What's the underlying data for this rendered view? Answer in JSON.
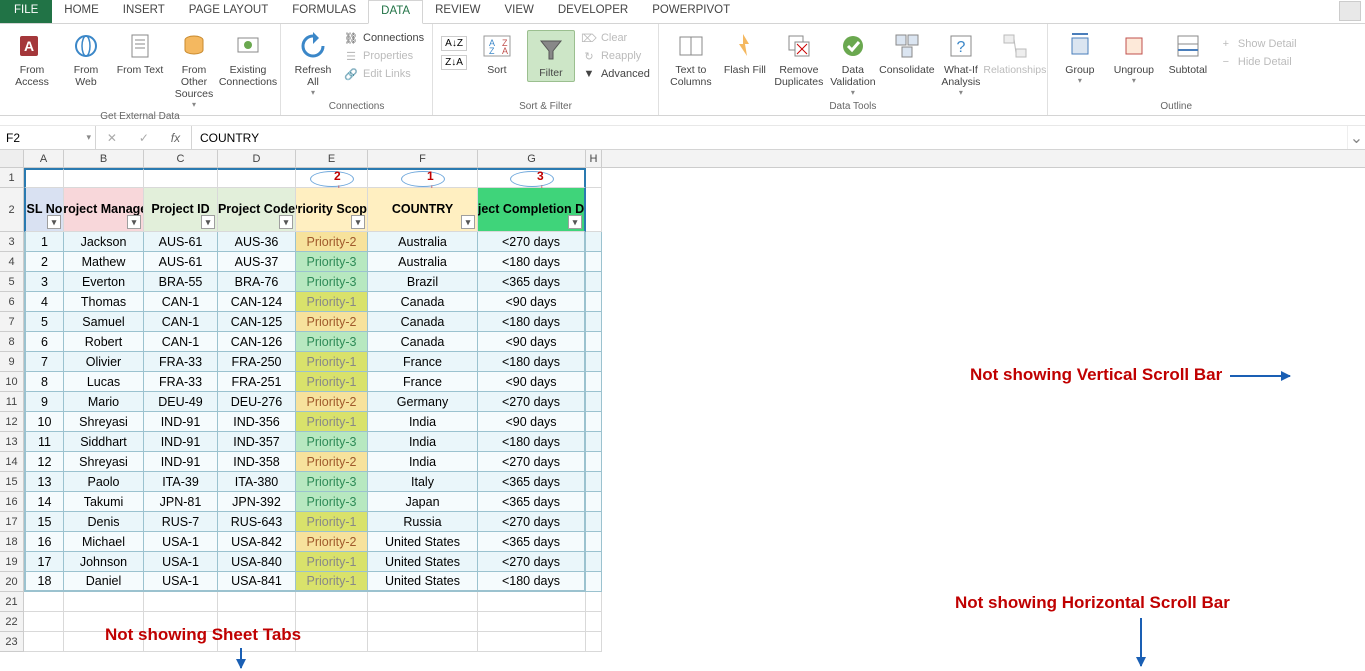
{
  "tabs": {
    "file": "FILE",
    "home": "HOME",
    "insert": "INSERT",
    "pagelayout": "PAGE LAYOUT",
    "formulas": "FORMULAS",
    "data": "DATA",
    "review": "REVIEW",
    "view": "VIEW",
    "developer": "DEVELOPER",
    "powerpivot": "POWERPIVOT"
  },
  "ribbon": {
    "getext": {
      "label": "Get External Data",
      "access": "From Access",
      "web": "From Web",
      "text": "From Text",
      "other": "From Other Sources",
      "existing": "Existing Connections"
    },
    "conn": {
      "label": "Connections",
      "refresh": "Refresh All",
      "connections": "Connections",
      "properties": "Properties",
      "editlinks": "Edit Links"
    },
    "sortfilter": {
      "label": "Sort & Filter",
      "azsort": "",
      "sort": "Sort",
      "filter": "Filter",
      "clear": "Clear",
      "reapply": "Reapply",
      "advanced": "Advanced"
    },
    "datatools": {
      "label": "Data Tools",
      "t2c": "Text to Columns",
      "flash": "Flash Fill",
      "remdup": "Remove Duplicates",
      "valid": "Data Validation",
      "consol": "Consolidate",
      "whatif": "What-If Analysis",
      "rel": "Relationships"
    },
    "outline": {
      "label": "Outline",
      "group": "Group",
      "ungroup": "Ungroup",
      "subtotal": "Subtotal",
      "showdetail": "Show Detail",
      "hidedetail": "Hide Detail"
    }
  },
  "namebox": "F2",
  "formulabar": "COUNTRY",
  "columns": [
    "A",
    "B",
    "C",
    "D",
    "E",
    "F",
    "G",
    "H"
  ],
  "headers": {
    "A": "SL No",
    "B": "Project Manager",
    "C": "Project ID",
    "D": "Project Code",
    "E": "Priority Scope",
    "F": "COUNTRY",
    "G": "Project Completion Days"
  },
  "sortnums": {
    "E": "2",
    "F": "1",
    "G": "3"
  },
  "rows": [
    {
      "n": "1",
      "mgr": "Jackson",
      "pid": "AUS-61",
      "code": "AUS-36",
      "prio": "Priority-2",
      "country": "Australia",
      "days": "<270 days"
    },
    {
      "n": "2",
      "mgr": "Mathew",
      "pid": "AUS-61",
      "code": "AUS-37",
      "prio": "Priority-3",
      "country": "Australia",
      "days": "<180 days"
    },
    {
      "n": "3",
      "mgr": "Everton",
      "pid": "BRA-55",
      "code": "BRA-76",
      "prio": "Priority-3",
      "country": "Brazil",
      "days": "<365 days"
    },
    {
      "n": "4",
      "mgr": "Thomas",
      "pid": "CAN-1",
      "code": "CAN-124",
      "prio": "Priority-1",
      "country": "Canada",
      "days": "<90 days"
    },
    {
      "n": "5",
      "mgr": "Samuel",
      "pid": "CAN-1",
      "code": "CAN-125",
      "prio": "Priority-2",
      "country": "Canada",
      "days": "<180 days"
    },
    {
      "n": "6",
      "mgr": "Robert",
      "pid": "CAN-1",
      "code": "CAN-126",
      "prio": "Priority-3",
      "country": "Canada",
      "days": "<90 days"
    },
    {
      "n": "7",
      "mgr": "Olivier",
      "pid": "FRA-33",
      "code": "FRA-250",
      "prio": "Priority-1",
      "country": "France",
      "days": "<180 days"
    },
    {
      "n": "8",
      "mgr": "Lucas",
      "pid": "FRA-33",
      "code": "FRA-251",
      "prio": "Priority-1",
      "country": "France",
      "days": "<90 days"
    },
    {
      "n": "9",
      "mgr": "Mario",
      "pid": "DEU-49",
      "code": "DEU-276",
      "prio": "Priority-2",
      "country": "Germany",
      "days": "<270 days"
    },
    {
      "n": "10",
      "mgr": "Shreyasi",
      "pid": "IND-91",
      "code": "IND-356",
      "prio": "Priority-1",
      "country": "India",
      "days": "<90 days"
    },
    {
      "n": "11",
      "mgr": "Siddhart",
      "pid": "IND-91",
      "code": "IND-357",
      "prio": "Priority-3",
      "country": "India",
      "days": "<180 days"
    },
    {
      "n": "12",
      "mgr": "Shreyasi",
      "pid": "IND-91",
      "code": "IND-358",
      "prio": "Priority-2",
      "country": "India",
      "days": "<270 days"
    },
    {
      "n": "13",
      "mgr": "Paolo",
      "pid": "ITA-39",
      "code": "ITA-380",
      "prio": "Priority-3",
      "country": "Italy",
      "days": "<365 days"
    },
    {
      "n": "14",
      "mgr": "Takumi",
      "pid": "JPN-81",
      "code": "JPN-392",
      "prio": "Priority-3",
      "country": "Japan",
      "days": "<365 days"
    },
    {
      "n": "15",
      "mgr": "Denis",
      "pid": "RUS-7",
      "code": "RUS-643",
      "prio": "Priority-1",
      "country": "Russia",
      "days": "<270 days"
    },
    {
      "n": "16",
      "mgr": "Michael",
      "pid": "USA-1",
      "code": "USA-842",
      "prio": "Priority-2",
      "country": "United States",
      "days": "<365 days"
    },
    {
      "n": "17",
      "mgr": "Johnson",
      "pid": "USA-1",
      "code": "USA-840",
      "prio": "Priority-1",
      "country": "United States",
      "days": "<270 days"
    },
    {
      "n": "18",
      "mgr": "Daniel",
      "pid": "USA-1",
      "code": "USA-841",
      "prio": "Priority-1",
      "country": "United States",
      "days": "<180 days"
    }
  ],
  "annotations": {
    "sheettabs": "Not showing Sheet Tabs",
    "vscroll": "Not showing Vertical Scroll Bar",
    "hscroll": "Not showing Horizontal Scroll Bar"
  }
}
